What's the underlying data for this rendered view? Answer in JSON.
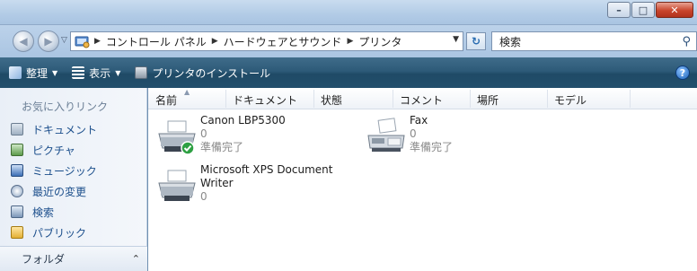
{
  "window": {
    "minimize_glyph": "–",
    "maximize_glyph": "□",
    "close_glyph": "✕"
  },
  "address": {
    "crumbs": [
      "コントロール パネル",
      "ハードウェアとサウンド",
      "プリンタ"
    ],
    "search_placeholder": "検索"
  },
  "toolbar": {
    "organize_label": "整理",
    "views_label": "表示",
    "add_printer_label": "プリンタのインストール",
    "help_glyph": "?"
  },
  "sidebar": {
    "title": "お気に入りリンク",
    "items": [
      {
        "label": "ドキュメント",
        "icon": "documents-icon"
      },
      {
        "label": "ピクチャ",
        "icon": "pictures-icon"
      },
      {
        "label": "ミュージック",
        "icon": "music-icon"
      },
      {
        "label": "最近の変更",
        "icon": "recent-icon"
      },
      {
        "label": "検索",
        "icon": "search-folder-icon"
      },
      {
        "label": "パブリック",
        "icon": "public-folder-icon"
      }
    ],
    "folders_label": "フォルダ"
  },
  "columns": [
    "名前",
    "ドキュメント",
    "状態",
    "コメント",
    "場所",
    "モデル"
  ],
  "printers": [
    {
      "name_line1": "Canon LBP5300",
      "name_line2": "",
      "documents": "0",
      "status": "準備完了",
      "is_default": true
    },
    {
      "name_line1": "Fax",
      "name_line2": "",
      "documents": "0",
      "status": "準備完了",
      "is_default": false
    },
    {
      "name_line1": "Microsoft XPS Document",
      "name_line2": "Writer",
      "documents": "0",
      "status": "",
      "is_default": false
    }
  ],
  "colors": {
    "toolbar_bg": "#2d5a78",
    "link_blue": "#1c4f8c",
    "default_check": "#2ea043"
  }
}
